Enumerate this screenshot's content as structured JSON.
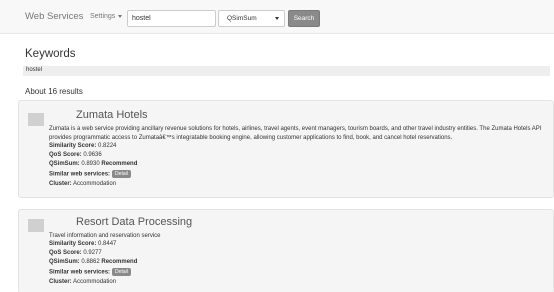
{
  "navbar": {
    "brand": "Web Services",
    "settings_label": "Settings",
    "search_value": "hostel",
    "select_value": "QSimSum",
    "search_button": "Search"
  },
  "keywords": {
    "title": "Keywords",
    "value": "hostel"
  },
  "results_count": "About 16 results",
  "labels": {
    "similarity": "Similarity Score:",
    "qos": "QoS Score:",
    "qsimsum": "QSimSum:",
    "similar_ws": "Similar web services:",
    "detail": "Detail",
    "cluster": "Cluster:"
  },
  "results": [
    {
      "title": "Zumata Hotels",
      "description": "Zumata is a web service providing ancillary revenue solutions for hotels, airlines, travel agents, event managers, tourism boards, and other travel industry entities. The Zumata Hotels API provides programmatic access to Zumataâ€™s integratable booking engine, allowing customer applications to find, book, and cancel hotel reservations.",
      "similarity": "0.8224",
      "qos": "0.9636",
      "qsimsum": "0.8930",
      "recommend": "Recommend",
      "cluster": "Accommodation"
    },
    {
      "title": "Resort Data Processing",
      "description": "Travel information and reservation service",
      "similarity": "0.8447",
      "qos": "0.9277",
      "qsimsum": "0.8862",
      "recommend": "Recommend",
      "cluster": "Accommodation"
    }
  ]
}
